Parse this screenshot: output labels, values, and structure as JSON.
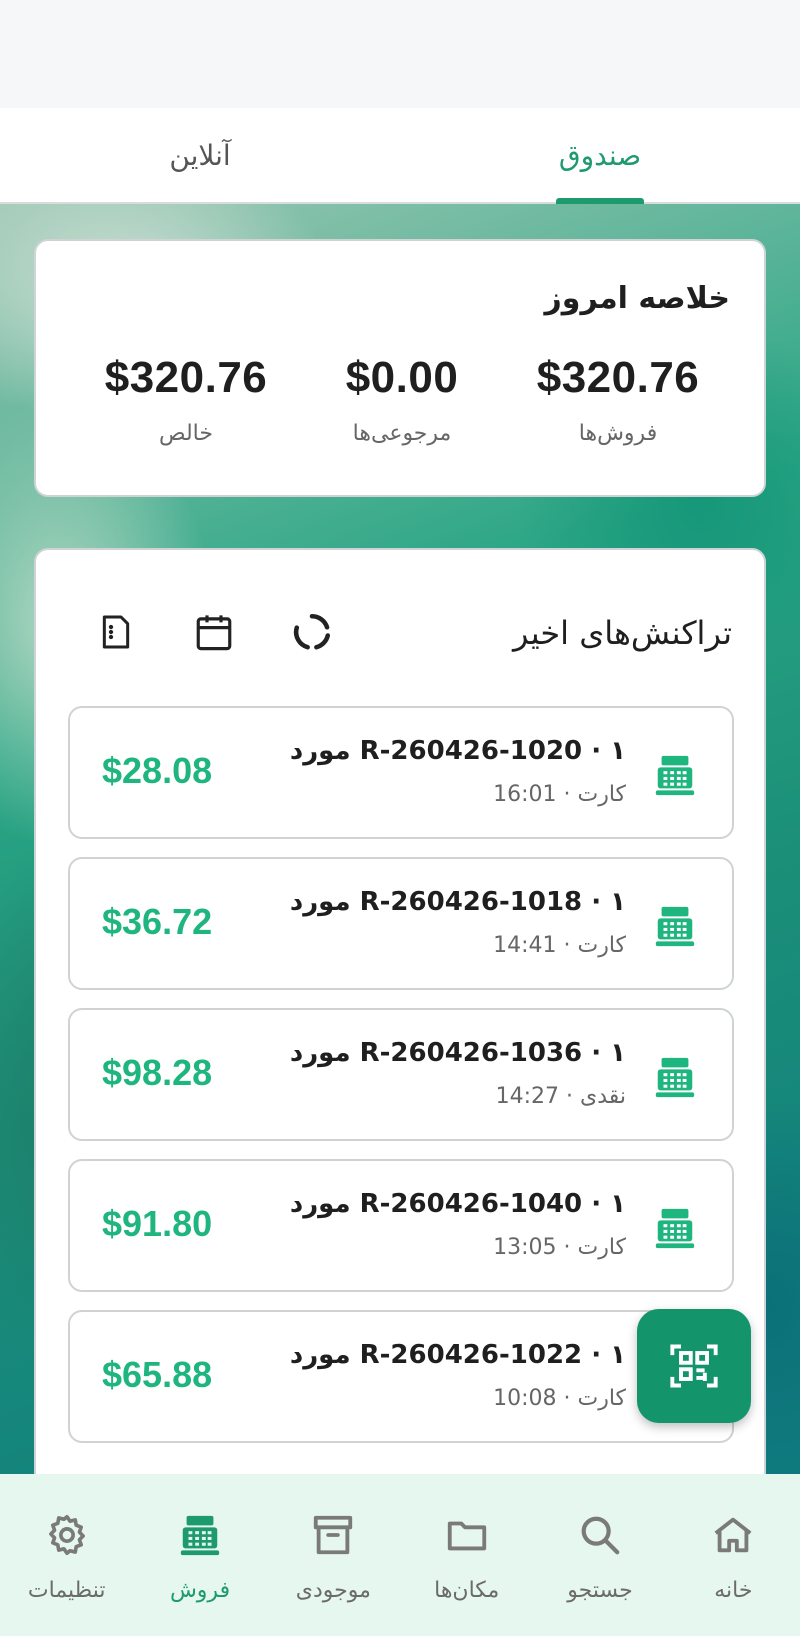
{
  "tabs": [
    {
      "label": "صندوق",
      "active": true
    },
    {
      "label": "آنلاین",
      "active": false
    }
  ],
  "summary": {
    "title": "خلاصه امروز",
    "stats": [
      {
        "value": "$320.76",
        "label": "فروش‌ها"
      },
      {
        "value": "$0.00",
        "label": "مرجوعی‌ها"
      },
      {
        "value": "$320.76",
        "label": "خالص"
      }
    ]
  },
  "recent": {
    "title": "تراکنش‌های اخیر",
    "actions": [
      "refresh-icon",
      "calendar-icon",
      "export-icon"
    ]
  },
  "transactions": [
    {
      "title": "R-260426-1020 · ۱ مورد",
      "subtitle": "کارت · 16:01",
      "amount": "$28.08"
    },
    {
      "title": "R-260426-1018 · ۱ مورد",
      "subtitle": "کارت · 14:41",
      "amount": "$36.72"
    },
    {
      "title": "R-260426-1036 · ۱ مورد",
      "subtitle": "نقدی · 14:27",
      "amount": "$98.28"
    },
    {
      "title": "R-260426-1040 · ۱ مورد",
      "subtitle": "کارت · 13:05",
      "amount": "$91.80"
    },
    {
      "title": "R-260426-1022 · ۱ مورد",
      "subtitle": "کارت · 10:08",
      "amount": "$65.88"
    }
  ],
  "fab": {
    "icon": "qr-scan-icon"
  },
  "nav": [
    {
      "label": "خانه",
      "icon": "home-icon"
    },
    {
      "label": "جستجو",
      "icon": "search-icon"
    },
    {
      "label": "مکان‌ها",
      "icon": "folder-icon"
    },
    {
      "label": "موجودی",
      "icon": "archive-icon"
    },
    {
      "label": "فروش",
      "icon": "cash-register-icon",
      "active": true
    },
    {
      "label": "تنظیمات",
      "icon": "settings-icon"
    }
  ],
  "colors": {
    "accent": "#1e9b6e",
    "amount": "#1fb57f",
    "fab": "#13946b",
    "nav_bg": "#e6f7ef"
  }
}
